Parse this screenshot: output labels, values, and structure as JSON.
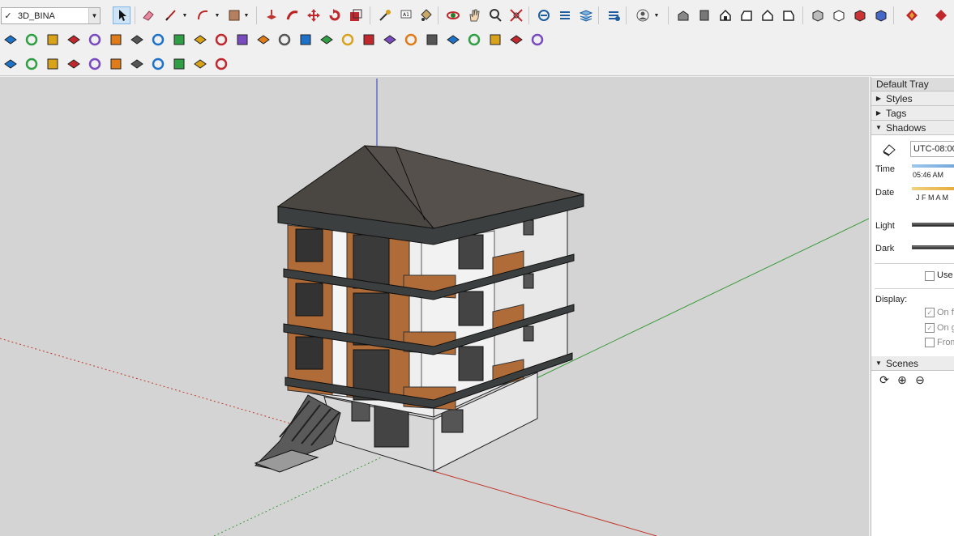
{
  "layer_dropdown": {
    "check": "✓",
    "value": "3D_BINA"
  },
  "toolbar": {
    "row1": [
      "select-tool",
      "eraser-tool",
      "pencil-line-tool",
      "arc-tool",
      "rectangle-tool",
      "push-pull-tool",
      "follow-me-tool",
      "move-tool",
      "rotate-tool",
      "scale-tool",
      "tape-measure-tool",
      "text-tool",
      "paint-bucket-tool",
      "orbit-tool",
      "pan-tool",
      "zoom-tool",
      "zoom-extents-tool",
      "warehouse-tool",
      "extension-tool",
      "layers-tool",
      "share-tool",
      "account-tool",
      "iso-view",
      "top-view",
      "front-view",
      "right-view",
      "back-view",
      "left-view",
      "xray-style",
      "wireframe-style",
      "hidden-line-style",
      "shaded-style",
      "monochrome-style",
      "textured-style"
    ],
    "row2": [
      "plugin-a",
      "plugin-b",
      "plugin-c",
      "plugin-d",
      "plugin-e",
      "plugin-f",
      "plugin-g",
      "plugin-h",
      "plugin-i",
      "plugin-j",
      "plugin-k",
      "plugin-l",
      "plugin-m",
      "plugin-n",
      "plugin-o",
      "plugin-p",
      "plugin-q",
      "plugin-r",
      "plugin-s",
      "plugin-t",
      "plugin-u",
      "plugin-v",
      "plugin-w",
      "plugin-x",
      "plugin-y",
      "plugin-z"
    ],
    "row3": [
      "extension-manager",
      "reload",
      "layers-panel",
      "add-icon",
      "tree-icon",
      "terrain-icon",
      "checker-icon",
      "cloud-icon",
      "settings-icon",
      "mail-icon",
      "info-icon"
    ]
  },
  "tray": {
    "title": "Default Tray",
    "panels": {
      "styles": "Styles",
      "tags": "Tags",
      "shadows": "Shadows",
      "scenes": "Scenes"
    },
    "shadows": {
      "timezone": "UTC-08:00",
      "time_label": "Time",
      "time_value": "05:46 AM",
      "date_label": "Date",
      "months": "J F M A M",
      "light_label": "Light",
      "dark_label": "Dark",
      "use_sun_label": "Use",
      "display_label": "Display:",
      "on_faces": "On f",
      "on_ground": "On g",
      "from_edges": "From"
    }
  },
  "colors": {
    "viewport_bg": "#d4d4d4",
    "axis_red": "#c0392b",
    "axis_green": "#3b9b3b",
    "axis_blue": "#2a37c8",
    "roof": "#4a4642",
    "wood": "#b06c38",
    "wall": "#eeeeee",
    "trim": "#3c3f3f"
  }
}
